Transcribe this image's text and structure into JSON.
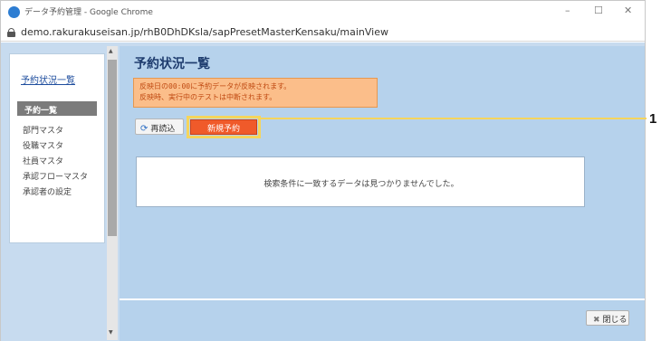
{
  "browser": {
    "title": "データ予約管理 - Google Chrome",
    "url": "demo.rakurakuseisan.jp/rhB0DhDKsla/sapPresetMasterKensaku/mainView",
    "controls": {
      "minimize": "–",
      "maximize": "☐",
      "close": "✕"
    }
  },
  "sidebar": {
    "top_link": "予約状況一覧",
    "section_header": "予約一覧",
    "items": [
      {
        "label": "部門マスタ"
      },
      {
        "label": "役職マスタ"
      },
      {
        "label": "社員マスタ"
      },
      {
        "label": "承認フローマスタ"
      },
      {
        "label": "承認者の設定"
      }
    ]
  },
  "main": {
    "title": "予約状況一覧",
    "notice_lines": [
      "反映日の00:00に予約データが反映されます。",
      "反映時、実行中のテストは中断されます。"
    ],
    "reload_button": {
      "icon": "⟳",
      "label": "再読込"
    },
    "new_reservation_button": "新規予約",
    "empty_result": "検索条件に一致するデータは見つかりませんでした。",
    "close_button": {
      "icon": "✖",
      "label": "閉じる"
    }
  },
  "annotation": {
    "number": "1"
  },
  "colors": {
    "page_bg": "#c7dbef",
    "notice_bg": "#fbbe8a",
    "notice_text": "#c04a12",
    "primary_button": "#f05a2a",
    "highlight": "#f5d55c",
    "title_color": "#1e3c6e"
  }
}
